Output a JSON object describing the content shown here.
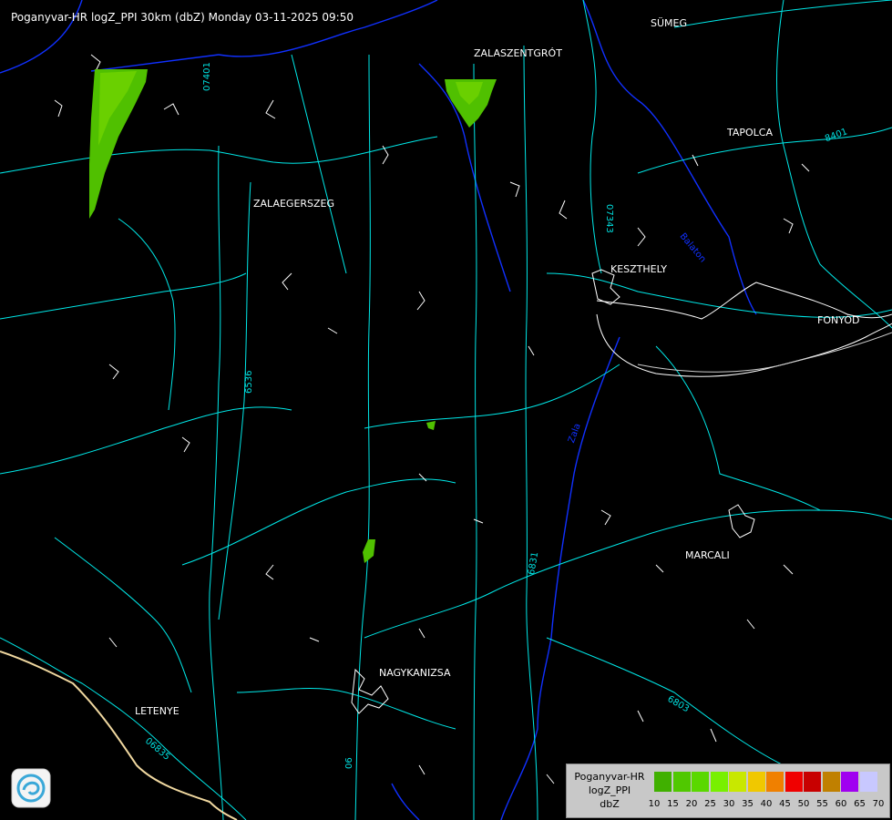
{
  "header": {
    "title": "Poganyvar-HR logZ_PPI 30km (dbZ) Monday 03-11-2025 09:50"
  },
  "places": [
    {
      "id": "sumeg",
      "label": "SÜMEG"
    },
    {
      "id": "zalaszentgrot",
      "label": "ZALASZENTGRÓT"
    },
    {
      "id": "tapolca",
      "label": "TAPOLCA"
    },
    {
      "id": "zalaegerszeg",
      "label": "ZALAEGERSZEG"
    },
    {
      "id": "keszthely",
      "label": "KESZTHELY"
    },
    {
      "id": "fonyod",
      "label": "FONYÓD"
    },
    {
      "id": "marcali",
      "label": "MARCALI"
    },
    {
      "id": "nagykanizsa",
      "label": "NAGYKANIZSA"
    },
    {
      "id": "letenye",
      "label": "LETENYE"
    }
  ],
  "roads": [
    "07401",
    "07343",
    "6536",
    "6831",
    "6803",
    "06835",
    "06",
    "8401"
  ],
  "rivers": [
    "Zala",
    "Balaton"
  ],
  "legend": {
    "line1": "Poganyvar-HR",
    "line2": "logZ_PPI",
    "line3": "dbZ",
    "ticks": [
      "10",
      "15",
      "20",
      "25",
      "30",
      "35",
      "40",
      "45",
      "50",
      "55",
      "60",
      "65",
      "70"
    ],
    "colors": [
      "#40b000",
      "#50c800",
      "#5ad800",
      "#78f000",
      "#c8e800",
      "#f0c800",
      "#f08000",
      "#f00000",
      "#c80000",
      "#c08000",
      "#a000f0",
      "#c8c8ff"
    ]
  },
  "colors": {
    "roads": "#00e0e0",
    "borders": "#ffffff",
    "rivers": "#0030ff",
    "echo": "#50c000",
    "lake": "#ffffff"
  }
}
